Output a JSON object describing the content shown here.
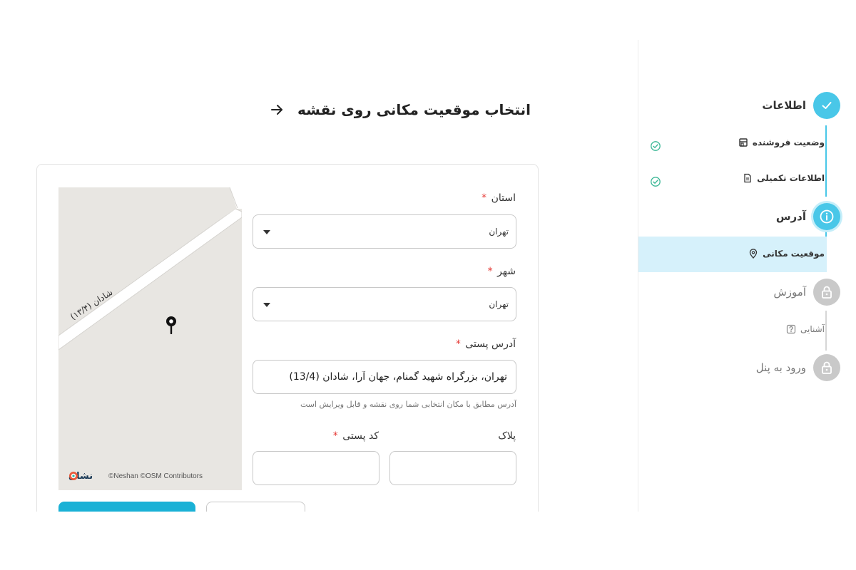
{
  "sidebar": {
    "steps": [
      {
        "label": "اطلاعات",
        "state": "done"
      },
      {
        "label": "آدرس",
        "state": "active"
      },
      {
        "label": "آموزش",
        "state": "locked"
      },
      {
        "label": "ورود به پنل",
        "state": "locked"
      }
    ],
    "substeps": {
      "seller_status": "وضعیت فروشنده",
      "extra_info": "اطلاعات تکمیلی",
      "location": "موقعیت مکانی",
      "familiarity": "آشنایی"
    }
  },
  "page": {
    "title": "انتخاب موقعیت مکانی روی نقشه"
  },
  "map": {
    "street": "شادان (۱۳/۴)",
    "credit": "©Neshan ©OSM Contributors",
    "logo": "نشان"
  },
  "form": {
    "province": {
      "label": "استان",
      "required_mark": "*",
      "value": "تهران"
    },
    "city": {
      "label": "شهر",
      "required_mark": "*",
      "value": "تهران"
    },
    "postal_address": {
      "label": "آدرس پستی",
      "required_mark": "*",
      "value": "تهران، بزرگراه شهید گمنام، جهان آرا، شادان (13/4)",
      "helper": "آدرس مطابق با مکان انتخابی شما روی نقشه و قابل ویرایش است"
    },
    "postal_code": {
      "label": "کد پستی",
      "required_mark": "*",
      "value": ""
    },
    "plaque": {
      "label": "پلاک",
      "value": ""
    }
  },
  "colors": {
    "accent": "#49c7e8",
    "primary_button": "#1ab1d6",
    "active_row": "#d6f1fb",
    "locked": "#c9c9c9",
    "required": "#e53935",
    "success": "#3ab795"
  }
}
